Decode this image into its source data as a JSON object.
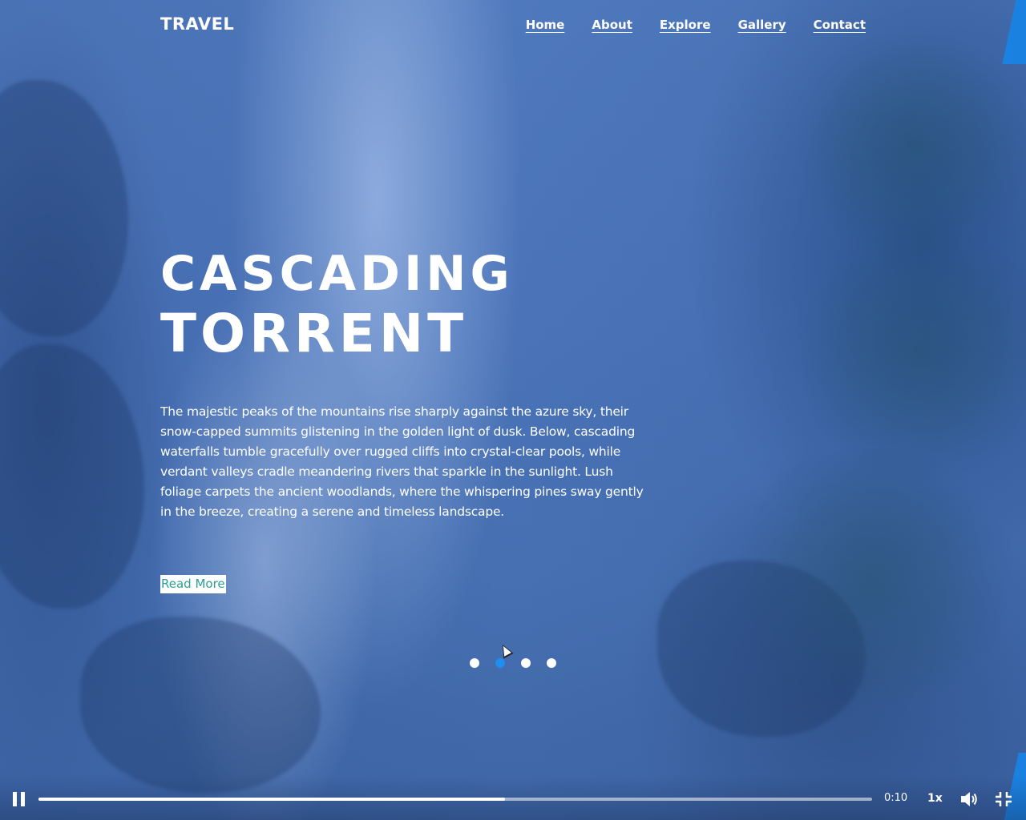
{
  "header": {
    "logo": "TRAVEL",
    "nav": [
      "Home",
      "About",
      "Explore",
      "Gallery",
      "Contact"
    ]
  },
  "hero": {
    "title_line1": "CASCADING",
    "title_line2": "TORRENT",
    "description": "The majestic peaks of the mountains rise sharply against the azure sky, their snow-capped summits glistening in the golden light of dusk. Below, cascading waterfalls tumble gracefully over rugged cliffs into crystal-clear pools, while verdant valleys cradle meandering rivers that sparkle in the sunlight. Lush foliage carpets the ancient woodlands, where the whispering pines sway gently in the breeze, creating a serene and timeless landscape.",
    "button_label": "Read More"
  },
  "slider": {
    "dot_count": 4,
    "active_index": 1
  },
  "video": {
    "state": "playing",
    "progress_fraction": 0.56,
    "time": "0:10",
    "speed": "1x"
  },
  "colors": {
    "accent": "#1e8ff0",
    "button_text": "#2e9f95",
    "background": "#4a73b8"
  }
}
